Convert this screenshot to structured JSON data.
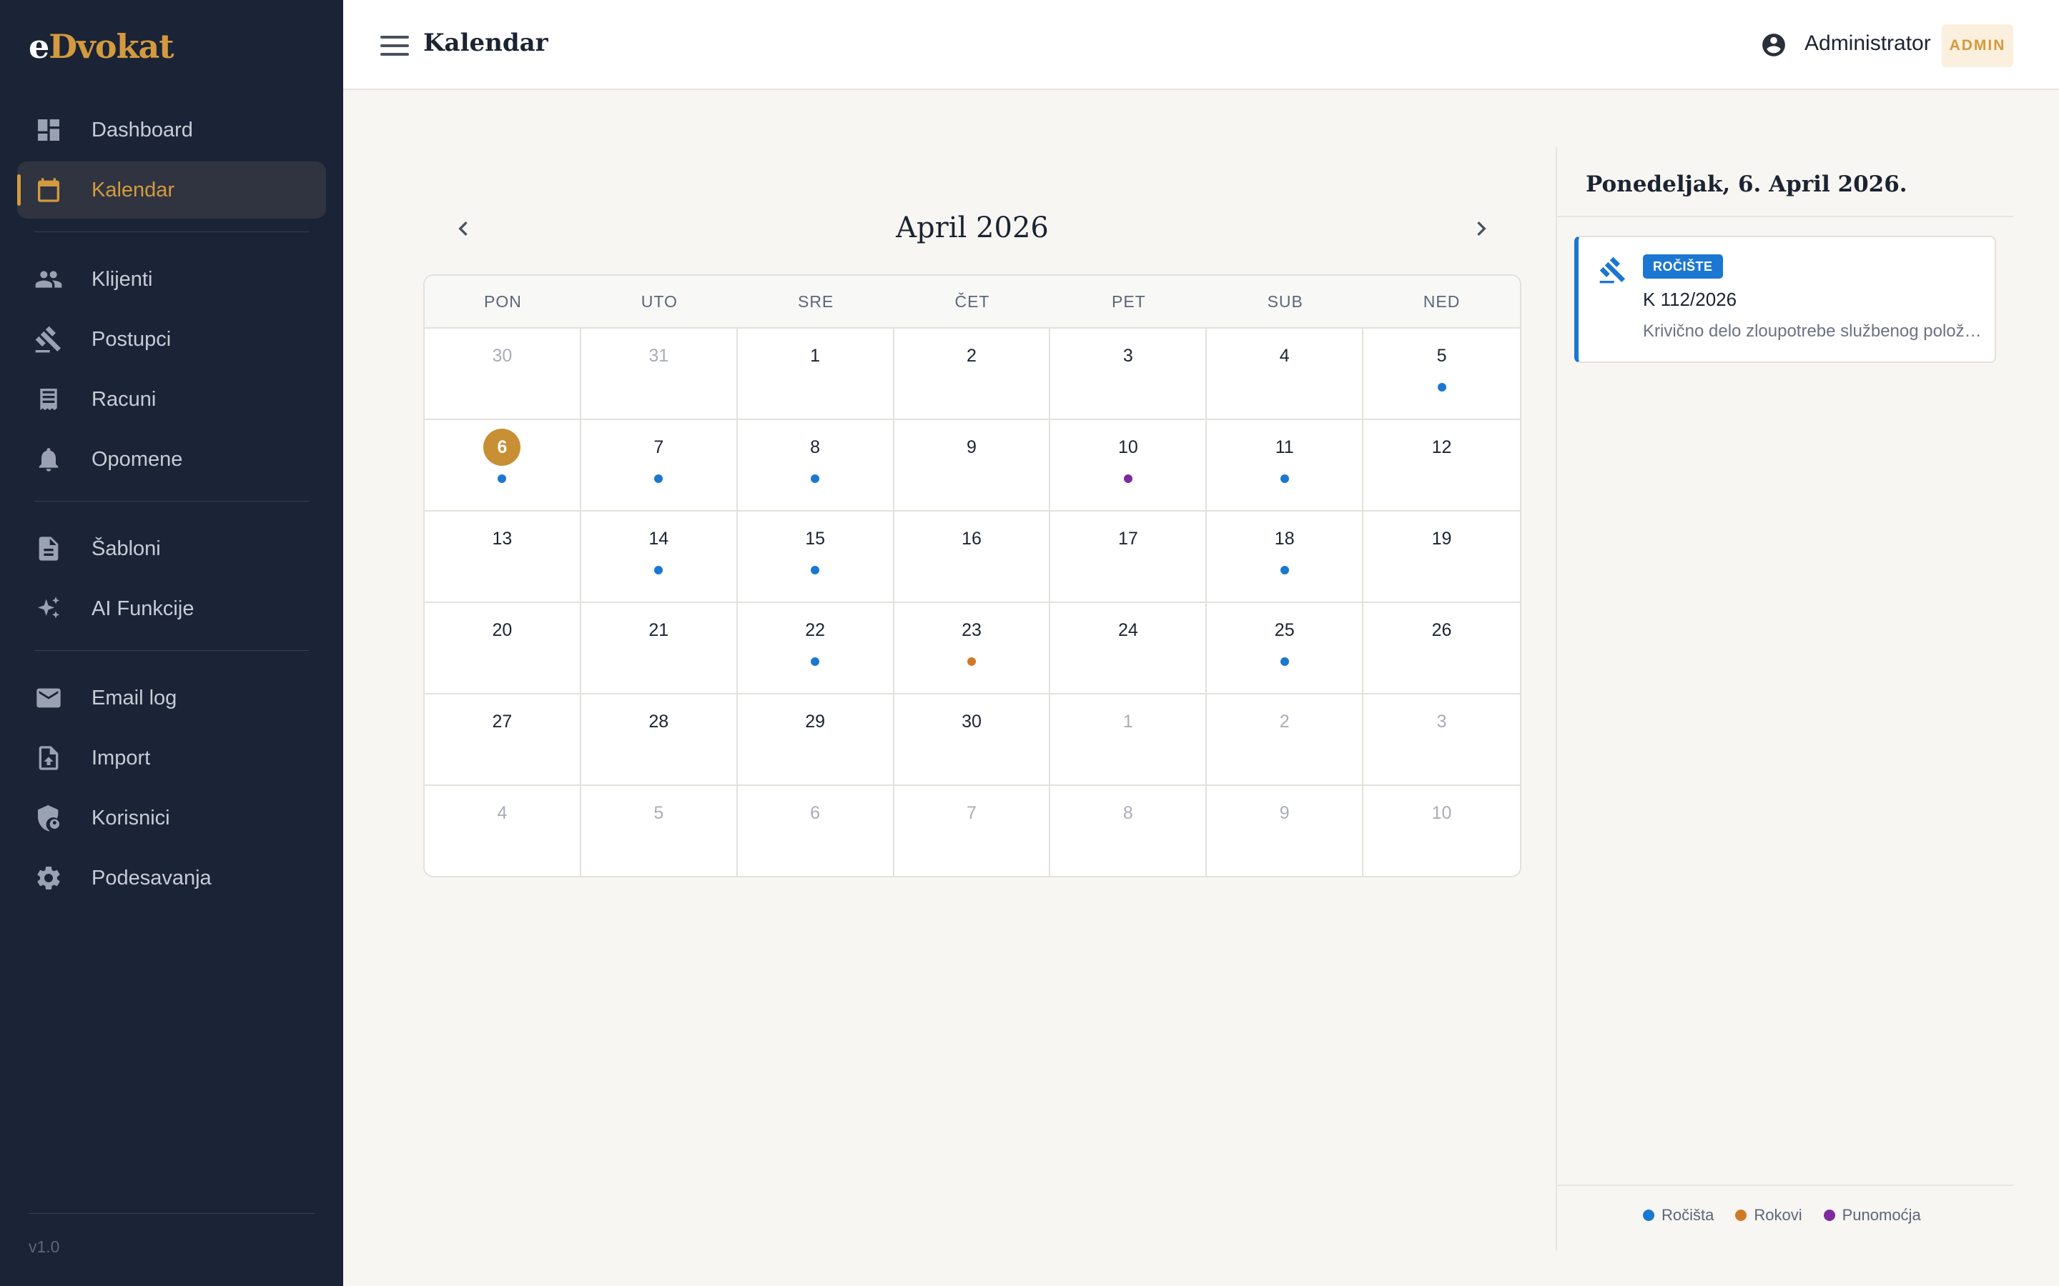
{
  "app": {
    "logo_first": "e",
    "logo_rest": "Dvokat",
    "version": "v1.0"
  },
  "sidebar": {
    "items": [
      {
        "label": "Dashboard",
        "icon": "dashboard-icon"
      },
      {
        "label": "Kalendar",
        "icon": "calendar-icon",
        "active": true
      },
      {
        "label": "Klijenti",
        "icon": "people-icon"
      },
      {
        "label": "Postupci",
        "icon": "gavel-icon"
      },
      {
        "label": "Racuni",
        "icon": "receipt-icon"
      },
      {
        "label": "Opomene",
        "icon": "bell-icon"
      },
      {
        "label": "Šabloni",
        "icon": "document-icon"
      },
      {
        "label": "AI Funkcije",
        "icon": "sparkle-icon"
      },
      {
        "label": "Email log",
        "icon": "mail-icon"
      },
      {
        "label": "Import",
        "icon": "upload-file-icon"
      },
      {
        "label": "Korisnici",
        "icon": "admin-shield-icon"
      },
      {
        "label": "Podesavanja",
        "icon": "gear-icon"
      }
    ]
  },
  "header": {
    "title": "Kalendar",
    "user_name": "Administrator",
    "role_badge": "ADMIN"
  },
  "calendar": {
    "month_label": "April 2026",
    "weekdays": [
      "PON",
      "UTO",
      "SRE",
      "ČET",
      "PET",
      "SUB",
      "NED"
    ],
    "days": [
      {
        "n": "30",
        "other": true
      },
      {
        "n": "31",
        "other": true
      },
      {
        "n": "1"
      },
      {
        "n": "2"
      },
      {
        "n": "3"
      },
      {
        "n": "4"
      },
      {
        "n": "5",
        "dot": "blue"
      },
      {
        "n": "6",
        "today": true,
        "dot": "blue"
      },
      {
        "n": "7",
        "dot": "blue"
      },
      {
        "n": "8",
        "dot": "blue"
      },
      {
        "n": "9"
      },
      {
        "n": "10",
        "dot": "purple"
      },
      {
        "n": "11",
        "dot": "blue"
      },
      {
        "n": "12"
      },
      {
        "n": "13"
      },
      {
        "n": "14",
        "dot": "blue"
      },
      {
        "n": "15",
        "dot": "blue"
      },
      {
        "n": "16"
      },
      {
        "n": "17"
      },
      {
        "n": "18",
        "dot": "blue"
      },
      {
        "n": "19"
      },
      {
        "n": "20"
      },
      {
        "n": "21"
      },
      {
        "n": "22",
        "dot": "blue"
      },
      {
        "n": "23",
        "dot": "orange"
      },
      {
        "n": "24"
      },
      {
        "n": "25",
        "dot": "blue"
      },
      {
        "n": "26"
      },
      {
        "n": "27"
      },
      {
        "n": "28"
      },
      {
        "n": "29"
      },
      {
        "n": "30"
      },
      {
        "n": "1",
        "other": true
      },
      {
        "n": "2",
        "other": true
      },
      {
        "n": "3",
        "other": true
      },
      {
        "n": "4",
        "other": true
      },
      {
        "n": "5",
        "other": true
      },
      {
        "n": "6",
        "other": true
      },
      {
        "n": "7",
        "other": true
      },
      {
        "n": "8",
        "other": true
      },
      {
        "n": "9",
        "other": true
      },
      {
        "n": "10",
        "other": true
      }
    ]
  },
  "panel": {
    "date_title": "Ponedeljak, 6. April 2026.",
    "events": [
      {
        "tag": "ROČIŠTE",
        "case_number": "K 112/2026",
        "description": "Krivično delo zloupotrebe službenog položaja",
        "icon": "gavel-icon"
      }
    ],
    "legend": [
      {
        "label": "Ročišta",
        "color": "#1b77d1"
      },
      {
        "label": "Rokovi",
        "color": "#d07a26"
      },
      {
        "label": "Punomoćja",
        "color": "#7e2b9e"
      }
    ]
  },
  "colors": {
    "accent": "#d49a3f",
    "sidebar_bg": "#1b2436",
    "event_blue": "#1b77d1",
    "deadline_orange": "#d07a26",
    "poa_purple": "#7e2b9e"
  }
}
